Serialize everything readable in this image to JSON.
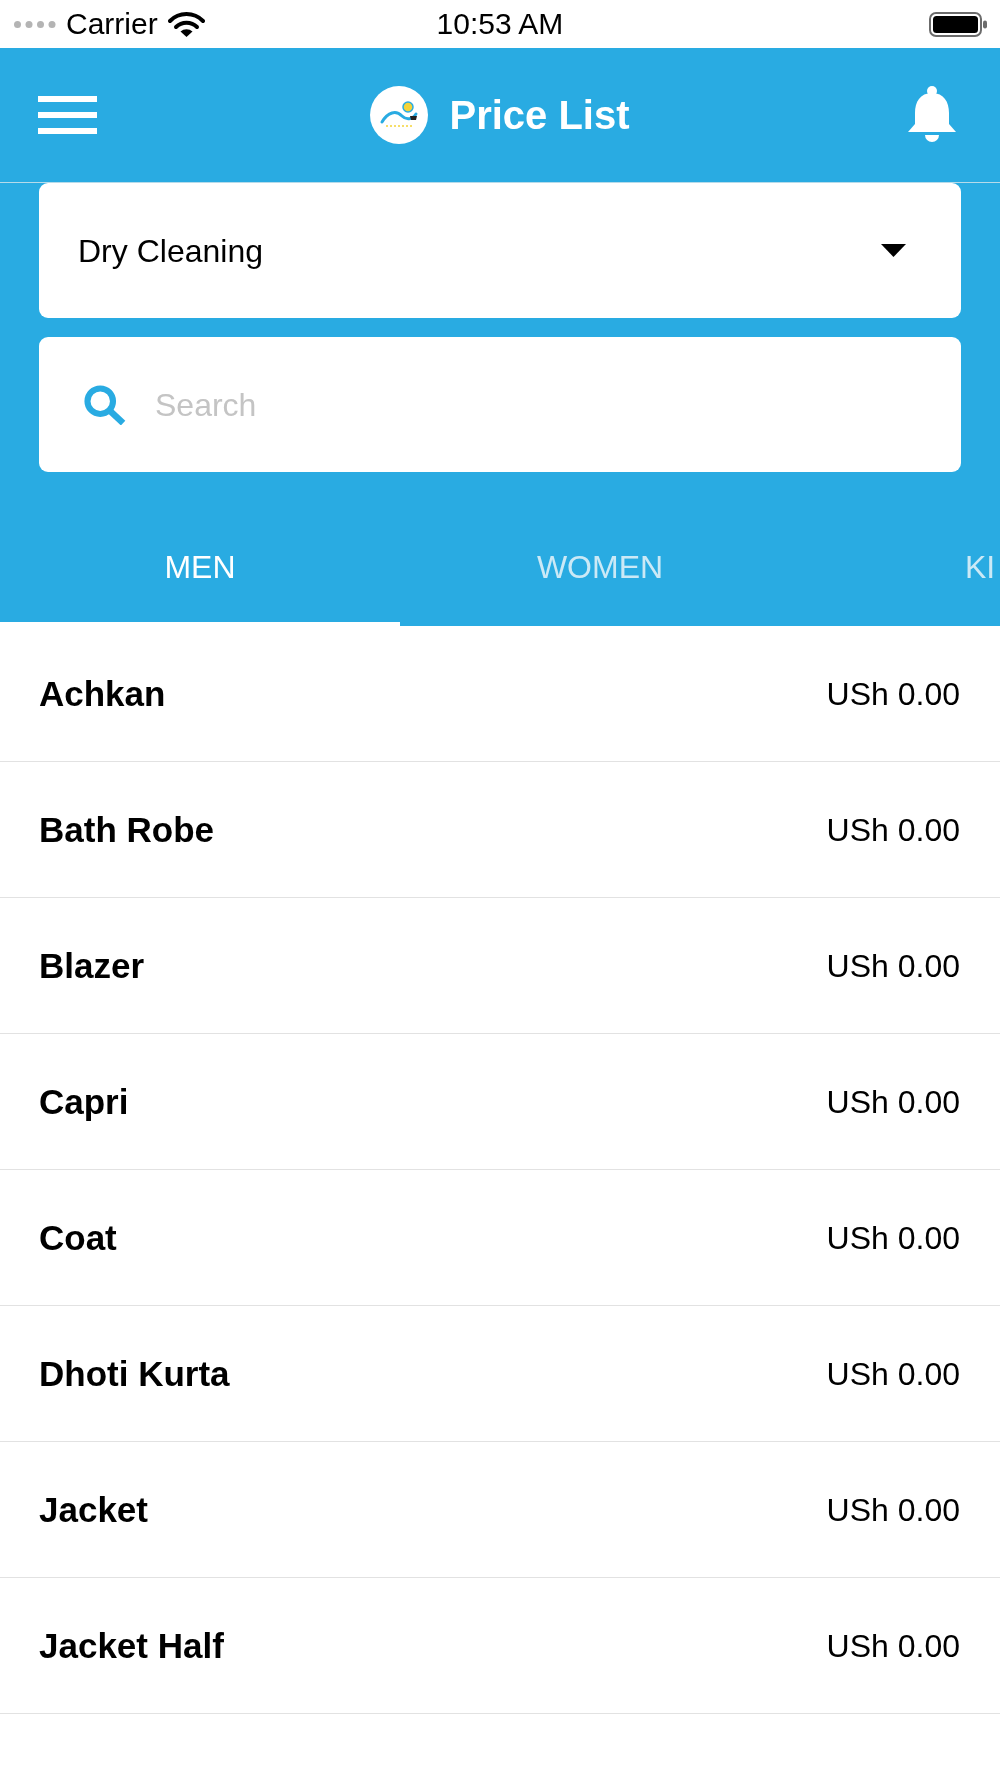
{
  "status_bar": {
    "carrier": "Carrier",
    "time": "10:53 AM"
  },
  "header": {
    "title": "Price List"
  },
  "service_dropdown": {
    "value": "Dry Cleaning"
  },
  "search": {
    "placeholder": "Search"
  },
  "tabs": [
    {
      "label": "MEN",
      "selected": true
    },
    {
      "label": "WOMEN",
      "selected": false
    },
    {
      "label": "KI",
      "selected": false
    }
  ],
  "price_list": [
    {
      "name": "Achkan",
      "price": "USh 0.00"
    },
    {
      "name": "Bath Robe",
      "price": "USh 0.00"
    },
    {
      "name": "Blazer",
      "price": "USh 0.00"
    },
    {
      "name": "Capri",
      "price": "USh 0.00"
    },
    {
      "name": "Coat",
      "price": "USh 0.00"
    },
    {
      "name": "Dhoti Kurta",
      "price": "USh 0.00"
    },
    {
      "name": "Jacket",
      "price": "USh 0.00"
    },
    {
      "name": "Jacket Half",
      "price": "USh 0.00"
    }
  ]
}
